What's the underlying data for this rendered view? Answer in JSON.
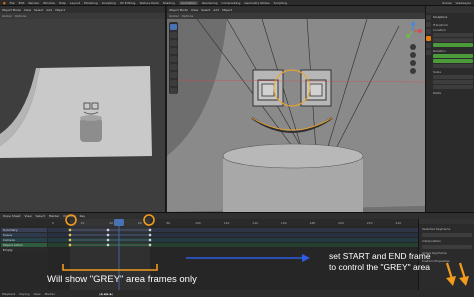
{
  "topbar": {
    "menus": [
      "File",
      "Edit",
      "Render",
      "Window",
      "Help"
    ],
    "workspaces": [
      "Layout",
      "Modeling",
      "Sculpting",
      "UV Editing",
      "Texture Paint",
      "Shading",
      "Animation",
      "Rendering",
      "Compositing",
      "Geometry Nodes",
      "Scripting"
    ],
    "scene": "Scene",
    "view_layer": "ViewLayer"
  },
  "left_viewport": {
    "header_items": [
      "Object Mode",
      "View",
      "Select",
      "Add",
      "Object"
    ],
    "sub_items": [
      "Global",
      "Options"
    ]
  },
  "right_viewport": {
    "header_items": [
      "Object Mode",
      "View",
      "Select",
      "Add",
      "Object"
    ],
    "sub_items": [
      "Global",
      "Options"
    ]
  },
  "properties": {
    "title": "Sculpture",
    "labels": [
      "Transform",
      "Location",
      "Rotation",
      "Scale",
      "Delta"
    ]
  },
  "timeline": {
    "header_items": [
      "Dope Sheet",
      "View",
      "Select",
      "Marker",
      "Channel",
      "Key"
    ],
    "ruler_ticks": [
      "0",
      "20",
      "40",
      "60",
      "80",
      "100",
      "120",
      "140",
      "160",
      "180",
      "200",
      "220",
      "240"
    ],
    "channels": [
      "Summary",
      "Scene",
      "Camera",
      "Object Action",
      "Empty"
    ],
    "side_labels": [
      "Selected Keyframe",
      "Interpolation",
      "Active Keyframe",
      "Custom Properties"
    ],
    "footer_items": [
      "Playback",
      "Keying",
      "View",
      "Marker"
    ]
  },
  "annotations": {
    "start_end_line1": "set START and END frame",
    "start_end_line2": "to control the \"GREY\" area",
    "grey_note": "Will show \"GREY\" area frames only"
  },
  "colors": {
    "annotation_orange": "#f39b1b",
    "annotation_blue": "#2f5de6",
    "selection_orange": "#f5a623",
    "key_active": "#f4d05a"
  }
}
